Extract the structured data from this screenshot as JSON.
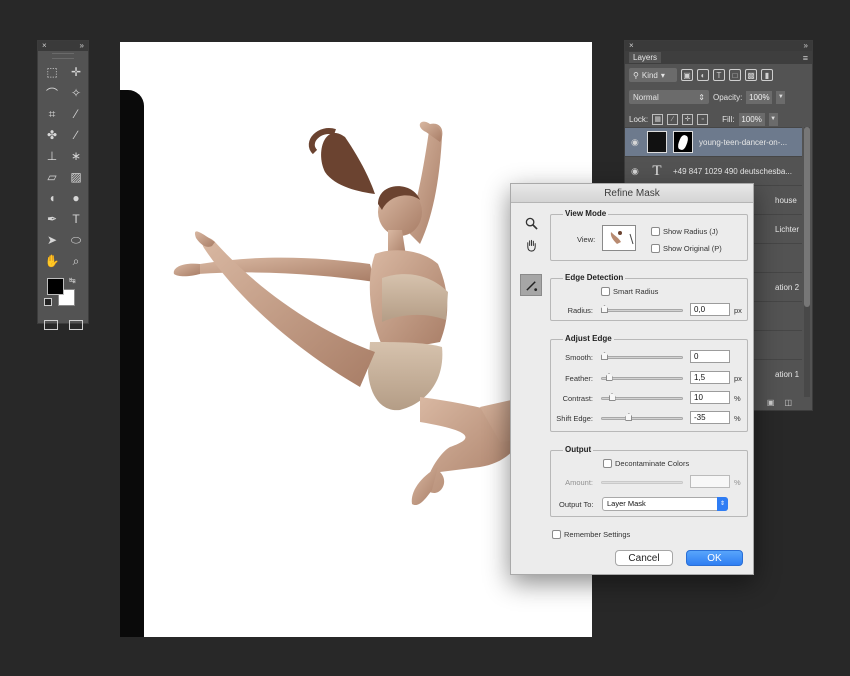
{
  "tools_panel": {
    "collapse_glyph": "»",
    "close_glyph": "×",
    "tools": [
      {
        "name": "rect-marquee-icon",
        "glyph": "⬚"
      },
      {
        "name": "move-icon",
        "glyph": "✛"
      },
      {
        "name": "lasso-icon",
        "glyph": "⌒"
      },
      {
        "name": "magic-wand-icon",
        "glyph": "✧"
      },
      {
        "name": "crop-icon",
        "glyph": "⌗"
      },
      {
        "name": "eyedropper-icon",
        "glyph": "⁄"
      },
      {
        "name": "healing-brush-icon",
        "glyph": "✤"
      },
      {
        "name": "brush-icon",
        "glyph": "∕"
      },
      {
        "name": "clone-stamp-icon",
        "glyph": "⊥"
      },
      {
        "name": "history-brush-icon",
        "glyph": "∗"
      },
      {
        "name": "eraser-icon",
        "glyph": "▱"
      },
      {
        "name": "gradient-icon",
        "glyph": "▨"
      },
      {
        "name": "blur-icon",
        "glyph": "◖"
      },
      {
        "name": "dodge-icon",
        "glyph": "●"
      },
      {
        "name": "pen-icon",
        "glyph": "✒"
      },
      {
        "name": "type-icon",
        "glyph": "T"
      },
      {
        "name": "path-selection-icon",
        "glyph": "➤"
      },
      {
        "name": "ellipse-icon",
        "glyph": "⬭"
      },
      {
        "name": "hand-icon",
        "glyph": "✋"
      },
      {
        "name": "zoom-icon",
        "glyph": "⌕"
      }
    ]
  },
  "layers_panel": {
    "tab_label": "Layers",
    "menu_glyph": "≡",
    "kind_label": "Kind",
    "blend_mode": "Normal",
    "opacity_label": "Opacity:",
    "opacity_value": "100%",
    "lock_label": "Lock:",
    "fill_label": "Fill:",
    "fill_value": "100%",
    "layers": [
      {
        "name": "young-teen-dancer-on-...",
        "type": "image",
        "active": true
      },
      {
        "name": "+49 847 1029 490 deutschesba...",
        "type": "text",
        "active": false
      },
      {
        "name": "house",
        "type": "hidden",
        "active": false
      },
      {
        "name": "Lichter",
        "type": "hidden",
        "active": false
      },
      {
        "name": "",
        "type": "hidden",
        "active": false
      },
      {
        "name": "ation 2",
        "type": "hidden",
        "active": false
      },
      {
        "name": "",
        "type": "hidden",
        "active": false
      },
      {
        "name": "",
        "type": "hidden",
        "active": false
      },
      {
        "name": "ation 1",
        "type": "hidden",
        "active": false
      }
    ]
  },
  "refine_mask": {
    "title": "Refine Mask",
    "view_mode": {
      "title": "View Mode",
      "view_label": "View:",
      "show_radius": "Show Radius (J)",
      "show_original": "Show Original (P)"
    },
    "edge_detection": {
      "title": "Edge Detection",
      "smart_radius": "Smart Radius",
      "radius_label": "Radius:",
      "radius_value": "0,0",
      "radius_unit": "px",
      "radius_fraction": 0.0
    },
    "adjust_edge": {
      "title": "Adjust Edge",
      "smooth_label": "Smooth:",
      "smooth_value": "0",
      "smooth_fraction": 0.0,
      "feather_label": "Feather:",
      "feather_value": "1,5",
      "feather_unit": "px",
      "feather_fraction": 0.06,
      "contrast_label": "Contrast:",
      "contrast_value": "10",
      "contrast_unit": "%",
      "contrast_fraction": 0.1,
      "shift_label": "Shift Edge:",
      "shift_value": "-35",
      "shift_unit": "%",
      "shift_fraction": 0.325
    },
    "output": {
      "title": "Output",
      "decontaminate": "Decontaminate Colors",
      "amount_label": "Amount:",
      "amount_unit": "%",
      "output_to_label": "Output To:",
      "output_to_value": "Layer Mask"
    },
    "remember_settings": "Remember Settings",
    "cancel_label": "Cancel",
    "ok_label": "OK"
  }
}
